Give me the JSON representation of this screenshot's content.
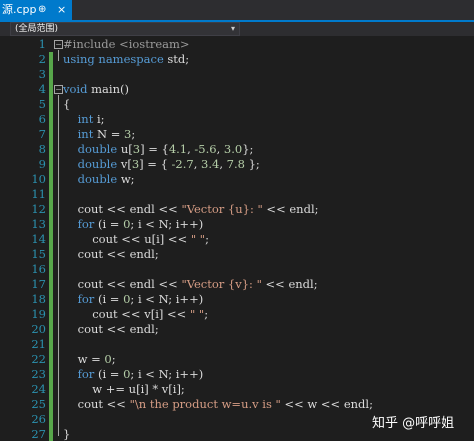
{
  "tab": {
    "title": "源.cpp",
    "pin_icon": "⊕",
    "close_icon": "×"
  },
  "scope": {
    "value": "(全局范围)",
    "arrow": "▾"
  },
  "lines": [
    {
      "n": "1",
      "tokens": [
        {
          "t": "#include <iostream>",
          "c": "pp"
        }
      ]
    },
    {
      "n": "2",
      "tokens": [
        {
          "t": "using namespace",
          "c": "kw"
        },
        {
          "t": " std;",
          "c": "plain"
        }
      ]
    },
    {
      "n": "3",
      "tokens": []
    },
    {
      "n": "4",
      "tokens": [
        {
          "t": "void",
          "c": "kw"
        },
        {
          "t": " main()",
          "c": "plain"
        }
      ]
    },
    {
      "n": "5",
      "tokens": [
        {
          "t": "{",
          "c": "plain"
        }
      ]
    },
    {
      "n": "6",
      "tokens": [
        {
          "t": "    int",
          "c": "kw"
        },
        {
          "t": " i;",
          "c": "plain"
        }
      ]
    },
    {
      "n": "7",
      "tokens": [
        {
          "t": "    int",
          "c": "kw"
        },
        {
          "t": " N = ",
          "c": "plain"
        },
        {
          "t": "3",
          "c": "num"
        },
        {
          "t": ";",
          "c": "plain"
        }
      ]
    },
    {
      "n": "8",
      "tokens": [
        {
          "t": "    double",
          "c": "kw"
        },
        {
          "t": " u[",
          "c": "plain"
        },
        {
          "t": "3",
          "c": "num"
        },
        {
          "t": "] = {",
          "c": "plain"
        },
        {
          "t": "4.1",
          "c": "num"
        },
        {
          "t": ", ",
          "c": "plain"
        },
        {
          "t": "-5.6",
          "c": "num"
        },
        {
          "t": ", ",
          "c": "plain"
        },
        {
          "t": "3.0",
          "c": "num"
        },
        {
          "t": "};",
          "c": "plain"
        }
      ]
    },
    {
      "n": "9",
      "tokens": [
        {
          "t": "    double",
          "c": "kw"
        },
        {
          "t": " v[",
          "c": "plain"
        },
        {
          "t": "3",
          "c": "num"
        },
        {
          "t": "] = { ",
          "c": "plain"
        },
        {
          "t": "-2.7",
          "c": "num"
        },
        {
          "t": ", ",
          "c": "plain"
        },
        {
          "t": "3.4",
          "c": "num"
        },
        {
          "t": ", ",
          "c": "plain"
        },
        {
          "t": "7.8",
          "c": "num"
        },
        {
          "t": " };",
          "c": "plain"
        }
      ]
    },
    {
      "n": "10",
      "tokens": [
        {
          "t": "    double",
          "c": "kw"
        },
        {
          "t": " w;",
          "c": "plain"
        }
      ]
    },
    {
      "n": "11",
      "tokens": []
    },
    {
      "n": "12",
      "tokens": [
        {
          "t": "    cout << endl << ",
          "c": "plain"
        },
        {
          "t": "\"Vector {u}: \"",
          "c": "str"
        },
        {
          "t": " << endl;",
          "c": "plain"
        }
      ]
    },
    {
      "n": "13",
      "tokens": [
        {
          "t": "    for",
          "c": "kw"
        },
        {
          "t": " (i = ",
          "c": "plain"
        },
        {
          "t": "0",
          "c": "num"
        },
        {
          "t": "; i < N; i++)",
          "c": "plain"
        }
      ]
    },
    {
      "n": "14",
      "tokens": [
        {
          "t": "        cout << u[i] << ",
          "c": "plain"
        },
        {
          "t": "\" \"",
          "c": "str"
        },
        {
          "t": ";",
          "c": "plain"
        }
      ]
    },
    {
      "n": "15",
      "tokens": [
        {
          "t": "    cout << endl;",
          "c": "plain"
        }
      ]
    },
    {
      "n": "16",
      "tokens": []
    },
    {
      "n": "17",
      "tokens": [
        {
          "t": "    cout << endl << ",
          "c": "plain"
        },
        {
          "t": "\"Vector {v}: \"",
          "c": "str"
        },
        {
          "t": " << endl;",
          "c": "plain"
        }
      ]
    },
    {
      "n": "18",
      "tokens": [
        {
          "t": "    for",
          "c": "kw"
        },
        {
          "t": " (i = ",
          "c": "plain"
        },
        {
          "t": "0",
          "c": "num"
        },
        {
          "t": "; i < N; i++)",
          "c": "plain"
        }
      ]
    },
    {
      "n": "19",
      "tokens": [
        {
          "t": "        cout << v[i] << ",
          "c": "plain"
        },
        {
          "t": "\" \"",
          "c": "str"
        },
        {
          "t": ";",
          "c": "plain"
        }
      ]
    },
    {
      "n": "20",
      "tokens": [
        {
          "t": "    cout << endl;",
          "c": "plain"
        }
      ]
    },
    {
      "n": "21",
      "tokens": []
    },
    {
      "n": "22",
      "tokens": [
        {
          "t": "    w = ",
          "c": "plain"
        },
        {
          "t": "0",
          "c": "num"
        },
        {
          "t": ";",
          "c": "plain"
        }
      ]
    },
    {
      "n": "23",
      "tokens": [
        {
          "t": "    for",
          "c": "kw"
        },
        {
          "t": " (i = ",
          "c": "plain"
        },
        {
          "t": "0",
          "c": "num"
        },
        {
          "t": "; i < N; i++)",
          "c": "plain"
        }
      ]
    },
    {
      "n": "24",
      "tokens": [
        {
          "t": "        w += u[i] * v[i];",
          "c": "plain"
        }
      ]
    },
    {
      "n": "25",
      "tokens": [
        {
          "t": "    cout << ",
          "c": "plain"
        },
        {
          "t": "\"\\n the product w=u.v is \"",
          "c": "str"
        },
        {
          "t": " << w << endl;",
          "c": "plain"
        }
      ]
    },
    {
      "n": "26",
      "tokens": []
    },
    {
      "n": "27",
      "tokens": [
        {
          "t": "}",
          "c": "plain"
        }
      ]
    }
  ],
  "changed_lines": [
    2,
    3,
    4,
    5,
    6,
    7,
    8,
    9,
    10,
    11,
    12,
    13,
    14,
    15,
    16,
    17,
    18,
    19,
    20,
    21,
    22,
    23,
    24,
    25,
    26,
    27
  ],
  "fold_lines": [
    1,
    4
  ],
  "fold_icon": "⊟",
  "watermark": "知乎 @呼呼姐",
  "colors": {
    "keyword": "#569cd6",
    "preprocessor": "#9b9b9b",
    "string": "#d69d85",
    "number": "#b5cea8",
    "text": "#dcdcdc",
    "line_number": "#2b91af",
    "change_bar": "#57a64a",
    "tab_active": "#007acc",
    "background": "#1e1e1e"
  }
}
